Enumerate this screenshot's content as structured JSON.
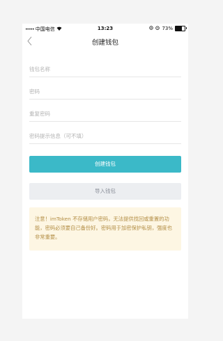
{
  "status_bar": {
    "signal_dots": "•••••",
    "carrier": "中国电信",
    "wifi_icon": "wifi-icon",
    "time": "13:23",
    "battery_percent": "73%",
    "battery_level": 0.73
  },
  "header": {
    "title": "创建钱包",
    "back_icon": "chevron-left-icon"
  },
  "form": {
    "wallet_name_placeholder": "钱包名称",
    "password_placeholder": "密码",
    "repeat_password_placeholder": "重复密码",
    "hint_placeholder": "密码提示信息（可不填）"
  },
  "buttons": {
    "create_label": "创建钱包",
    "import_label": "导入钱包"
  },
  "notice": {
    "text": "注意！imToken 不存储用户密码，无法提供找回或重置的功能，密码必须要自己备份好。密码用于加密保护私钥，强度也非常重要。"
  },
  "colors": {
    "accent": "#3bb9c8",
    "notice_bg": "#fdf6e3",
    "notice_text": "#b38e45"
  }
}
